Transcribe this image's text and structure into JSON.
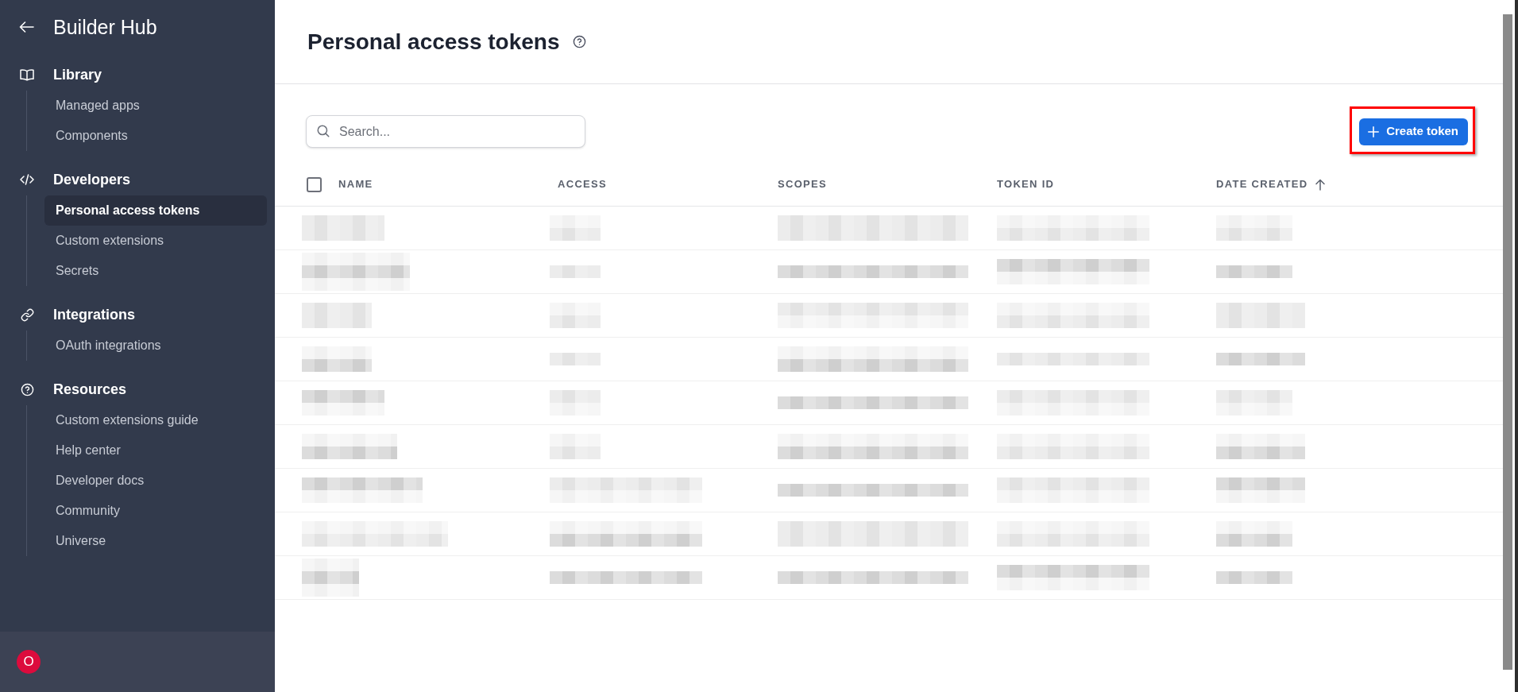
{
  "sidebar": {
    "title": "Builder Hub",
    "sections": [
      {
        "label": "Library",
        "items": [
          {
            "label": "Managed apps",
            "selected": false
          },
          {
            "label": "Components",
            "selected": false
          }
        ]
      },
      {
        "label": "Developers",
        "items": [
          {
            "label": "Personal access tokens",
            "selected": true
          },
          {
            "label": "Custom extensions",
            "selected": false
          },
          {
            "label": "Secrets",
            "selected": false
          }
        ]
      },
      {
        "label": "Integrations",
        "items": [
          {
            "label": "OAuth integrations",
            "selected": false
          }
        ]
      },
      {
        "label": "Resources",
        "items": [
          {
            "label": "Custom extensions guide",
            "selected": false
          },
          {
            "label": "Help center",
            "selected": false
          },
          {
            "label": "Developer docs",
            "selected": false
          },
          {
            "label": "Community",
            "selected": false
          },
          {
            "label": "Universe",
            "selected": false
          }
        ]
      }
    ],
    "user_avatar": {
      "initial": "O"
    }
  },
  "page": {
    "title": "Personal access tokens"
  },
  "toolbar": {
    "search": {
      "placeholder": "Search..."
    },
    "create_button": {
      "label": "Create token",
      "highlighted": true
    }
  },
  "table": {
    "select_all": {
      "checked": false
    },
    "columns": [
      {
        "label": "NAME",
        "sorted": false
      },
      {
        "label": "ACCESS",
        "sorted": false
      },
      {
        "label": "SCOPES",
        "sorted": false
      },
      {
        "label": "TOKEN ID",
        "sorted": false
      },
      {
        "label": "DATE CREATED",
        "sorted": true
      }
    ],
    "rows": [
      {
        "kind": "redacted"
      },
      {
        "kind": "redacted"
      },
      {
        "kind": "redacted"
      },
      {
        "kind": "redacted"
      },
      {
        "kind": "redacted"
      },
      {
        "kind": "redacted"
      },
      {
        "kind": "redacted"
      },
      {
        "kind": "redacted"
      },
      {
        "kind": "redacted"
      }
    ]
  }
}
